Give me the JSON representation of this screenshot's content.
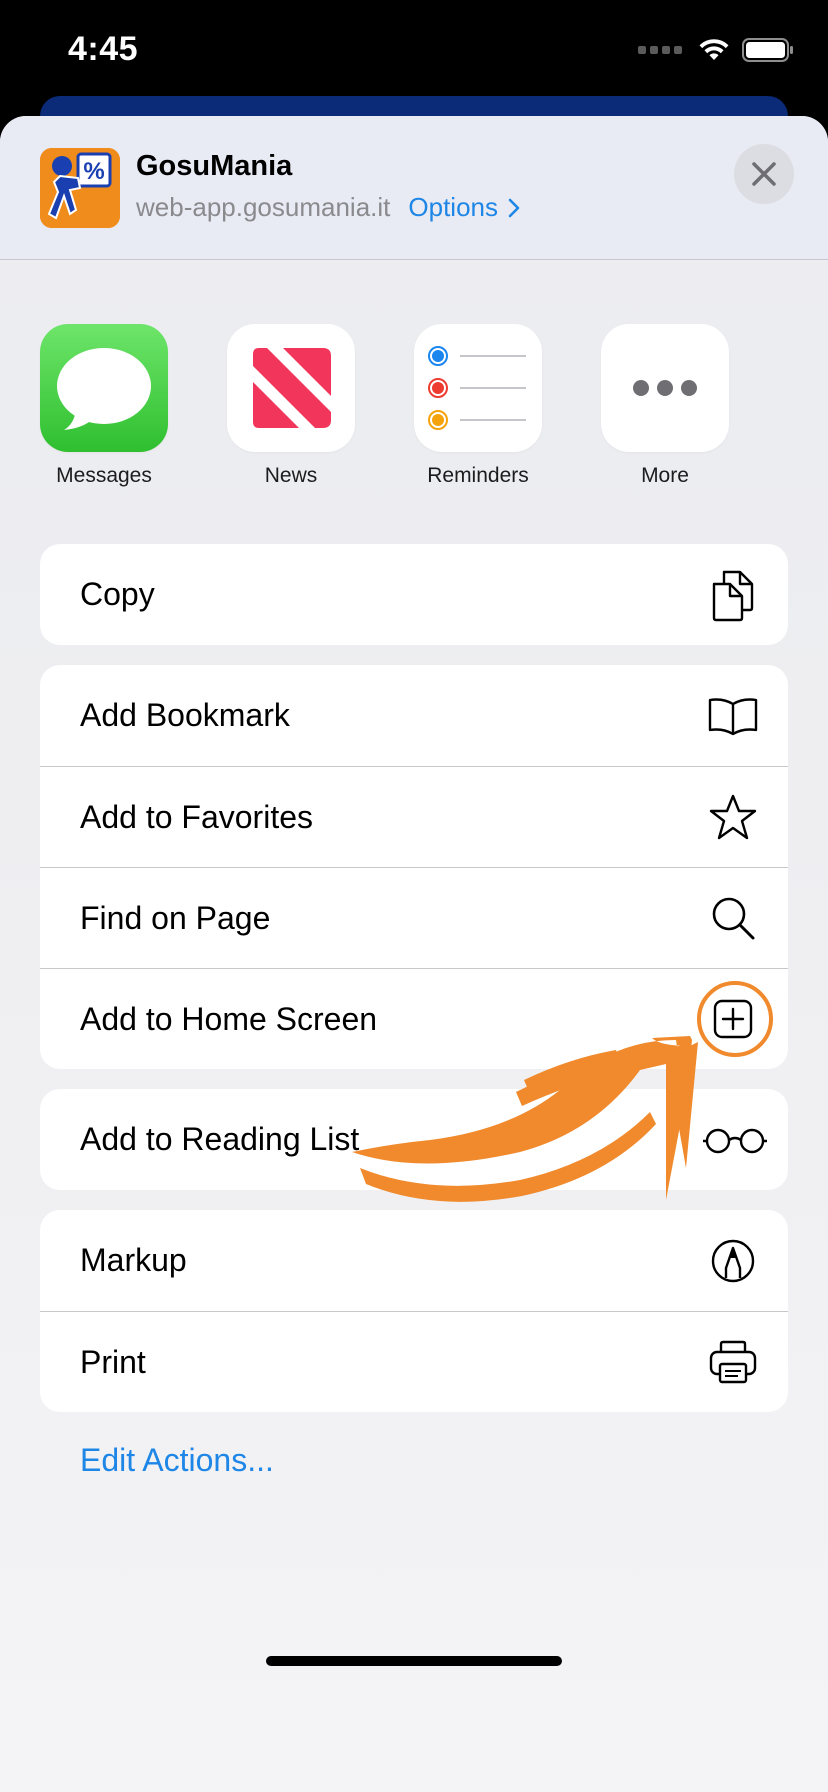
{
  "status_bar": {
    "time": "4:45"
  },
  "header": {
    "title": "GosuMania",
    "url": "web-app.gosumania.it",
    "options_label": "Options"
  },
  "apps": [
    {
      "label": "Messages",
      "icon": "messages-icon"
    },
    {
      "label": "News",
      "icon": "news-icon"
    },
    {
      "label": "Reminders",
      "icon": "reminders-icon"
    },
    {
      "label": "More",
      "icon": "more-icon"
    }
  ],
  "actions": {
    "group1": [
      {
        "label": "Copy",
        "icon": "copy-icon"
      }
    ],
    "group2": [
      {
        "label": "Add Bookmark",
        "icon": "book-icon"
      },
      {
        "label": "Add to Favorites",
        "icon": "star-icon"
      },
      {
        "label": "Find on Page",
        "icon": "search-icon"
      },
      {
        "label": "Add to Home Screen",
        "icon": "plus-square-icon"
      }
    ],
    "group3": [
      {
        "label": "Add to Reading List",
        "icon": "glasses-icon"
      }
    ],
    "group4": [
      {
        "label": "Markup",
        "icon": "markup-icon"
      },
      {
        "label": "Print",
        "icon": "printer-icon"
      }
    ]
  },
  "edit_actions_label": "Edit Actions...",
  "colors": {
    "accent": "#1e86e6",
    "annotation": "#f08a2c"
  }
}
